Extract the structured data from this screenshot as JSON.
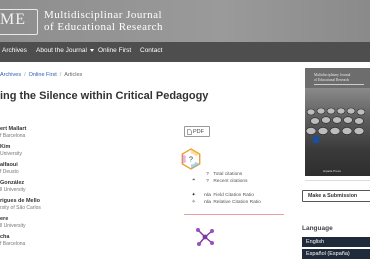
{
  "header": {
    "logo_text": "ME",
    "title_line1": "Multidisciplinar Journal",
    "title_line2": "of Educational Research"
  },
  "nav": {
    "items": [
      "Archives",
      "About the Journal",
      "Online First",
      "Contact"
    ]
  },
  "breadcrumb": [
    "Archives",
    "Online First",
    "Articles"
  ],
  "article": {
    "title": "ing the Silence within Critical Pedagogy",
    "authors": [
      {
        "name": "ert Mallart",
        "affiliation": "f Barcelona"
      },
      {
        "name": "Kim",
        "affiliation": "University"
      },
      {
        "name": "alfaoui",
        "affiliation": "f Deusto"
      },
      {
        "name": "González",
        "affiliation": "ll University"
      },
      {
        "name": "rigues de Mello",
        "affiliation": "rsity of São Carlos"
      },
      {
        "name": "ere",
        "affiliation": "ll University"
      },
      {
        "name": "cha",
        "affiliation": "f Barcelona"
      }
    ]
  },
  "pdf": {
    "label": "PDF"
  },
  "metrics": [
    {
      "value": "?",
      "label": "Total citations"
    },
    {
      "value": "?",
      "label": "Recent citations"
    },
    {
      "value": "n/a",
      "label": "Field Citation Ratio"
    },
    {
      "value": "n/a",
      "label": "Relative Citation Ratio"
    }
  ],
  "cover": {
    "title_line1": "Multidisciplinary Journal",
    "title_line2": "of Educational Research",
    "footer": "Hipatia Press"
  },
  "sidebar": {
    "submit_label": "Make a Submission",
    "language_heading": "Language",
    "languages": [
      "English",
      "Español (España)"
    ]
  },
  "colors": {
    "header_bg": "#969696",
    "nav_bg": "#4e4e4e",
    "link": "#2a5db0",
    "lang_button_bg": "#1f2b3a",
    "divider": "#e6a0a0"
  }
}
